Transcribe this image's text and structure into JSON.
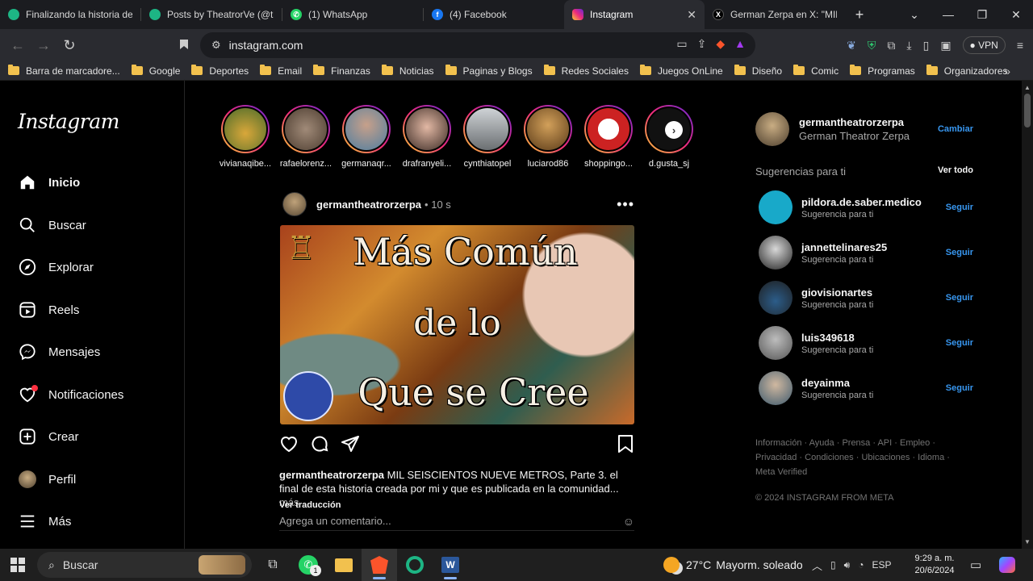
{
  "browser": {
    "tabs": [
      {
        "title": "Finalizando la historia de l",
        "color": "#1db584"
      },
      {
        "title": "Posts by TheatrorVe (@the",
        "color": "#1db584"
      },
      {
        "title": "(1) WhatsApp",
        "color": "#25d366"
      },
      {
        "title": "(4) Facebook",
        "color": "#1877f2"
      },
      {
        "title": "Instagram",
        "color": "#dd2a7b"
      },
      {
        "title": "German Zerpa en X: \"MIL S",
        "color": "#000000"
      }
    ],
    "url": "instagram.com",
    "vpn_label": "VPN",
    "bookmarks": [
      "Barra de marcadore...",
      "Google",
      "Deportes",
      "Email",
      "Finanzas",
      "Noticias",
      "Paginas y Blogs",
      "Redes Sociales",
      "Juegos OnLine",
      "Diseño",
      "Comic",
      "Programas",
      "Organizadores"
    ]
  },
  "instagram": {
    "logo": "Instagram",
    "nav": [
      "Inicio",
      "Buscar",
      "Explorar",
      "Reels",
      "Mensajes",
      "Notificaciones",
      "Crear",
      "Perfil",
      "Más"
    ],
    "stories": [
      "vivianaqibe...",
      "rafaelorenz...",
      "germanaqr...",
      "drafranyeli...",
      "cynthiatopel",
      "luciarod86",
      "shoppingo...",
      "d.gusta_sj"
    ],
    "story_colors": [
      "#c89b3b",
      "#7a6a5a",
      "#5c8fb0",
      "#a56b5a",
      "#8a8a8a",
      "#b07a3a",
      "#cc2222",
      "#ffffff"
    ],
    "post": {
      "user": "germantheatrorzerpa",
      "time": "10 s",
      "image_lines": [
        "Más Común",
        "de lo",
        "Que se Cree"
      ],
      "caption_user": "germantheatrorzerpa",
      "caption_text": "MIL SEISCIENTOS NUEVE METROS, Parte 3. el final de esta historia creada por mi y que es publicada en la comunidad...",
      "more": "más",
      "translate": "Ver traducción",
      "comment_placeholder": "Agrega un comentario..."
    },
    "profile": {
      "username": "germantheatrorzerpa",
      "name": "German Theatror Zerpa",
      "switch_label": "Cambiar"
    },
    "suggestions_title": "Sugerencias para ti",
    "see_all": "Ver todo",
    "suggestions": [
      {
        "user": "pildora.de.saber.medico",
        "sub": "Sugerencia para ti",
        "action": "Seguir",
        "color": "#18a9c9"
      },
      {
        "user": "jannettelinares25",
        "sub": "Sugerencia para ti",
        "action": "Seguir",
        "color": "#4a4a4a"
      },
      {
        "user": "giovisionartes",
        "sub": "Sugerencia para ti",
        "action": "Seguir",
        "color": "#3b3b3b"
      },
      {
        "user": "luis349618",
        "sub": "Sugerencia para ti",
        "action": "Seguir",
        "color": "#777777"
      },
      {
        "user": "deyainma",
        "sub": "Sugerencia para ti",
        "action": "Seguir",
        "color": "#5a6f80"
      }
    ],
    "footer": [
      "Información",
      "Ayuda",
      "Prensa",
      "API",
      "Empleo",
      "Privacidad",
      "Condiciones",
      "Ubicaciones",
      "Idioma",
      "Meta Verified"
    ],
    "copyright": "© 2024 INSTAGRAM FROM META"
  },
  "taskbar": {
    "search": "Buscar",
    "whatsapp_badge": "1",
    "temp": "27°C",
    "weather": "Mayorm. soleado",
    "lang": "ESP",
    "time": "9:29 a. m.",
    "date": "20/6/2024"
  }
}
